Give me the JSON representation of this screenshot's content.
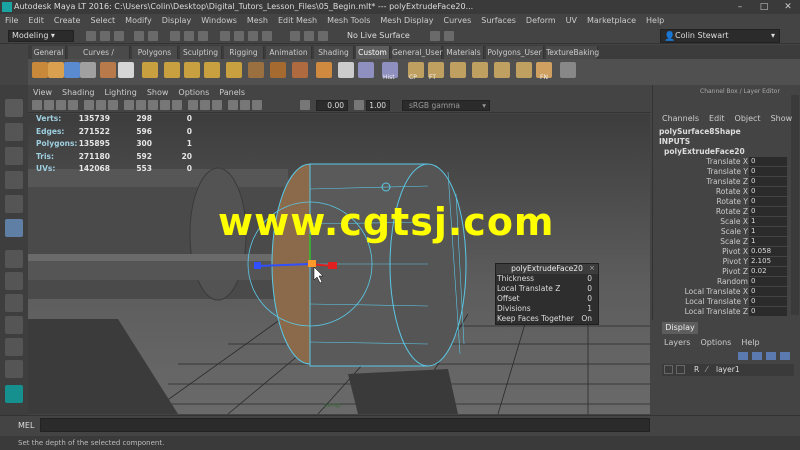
{
  "window": {
    "title": "Autodesk Maya LT 2016: C:\\Users\\Colin\\Desktop\\Digital_Tutors_Lesson_Files\\05_Begin.mlt*  ---  polyExtrudeFace20..."
  },
  "menubar": [
    "File",
    "Edit",
    "Create",
    "Select",
    "Modify",
    "Display",
    "Windows",
    "Mesh",
    "Edit Mesh",
    "Mesh Tools",
    "Mesh Display",
    "Curves",
    "Surfaces",
    "Deform",
    "UV",
    "Marketplace",
    "Help"
  ],
  "status_line": {
    "mode": "Modeling",
    "live_surface": "No Live Surface",
    "user": "Colin Stewart"
  },
  "shelf_tabs": [
    {
      "label": "General",
      "active": false
    },
    {
      "label": "Curves / Surfaces",
      "active": false
    },
    {
      "label": "Polygons",
      "active": false
    },
    {
      "label": "Sculpting",
      "active": false
    },
    {
      "label": "Rigging",
      "active": false
    },
    {
      "label": "Animation",
      "active": false
    },
    {
      "label": "Shading",
      "active": false
    },
    {
      "label": "Custom",
      "active": true
    },
    {
      "label": "General_User",
      "active": false
    },
    {
      "label": "Materials",
      "active": false
    },
    {
      "label": "Polygons_User",
      "active": false
    },
    {
      "label": "TextureBaking",
      "active": false
    }
  ],
  "shelf_labels": {
    "hist": "Hist",
    "cp": "CP",
    "ft": "FT",
    "fn": "FN"
  },
  "viewport": {
    "menu": [
      "View",
      "Shading",
      "Lighting",
      "Show",
      "Options",
      "Panels"
    ],
    "field1": "0.00",
    "field2": "1.00",
    "color_space": "sRGB gamma",
    "hud": [
      {
        "label": "Verts:",
        "a": "135739",
        "b": "298",
        "c": "0"
      },
      {
        "label": "Edges:",
        "a": "271522",
        "b": "596",
        "c": "0"
      },
      {
        "label": "Polygons:",
        "a": "135895",
        "b": "300",
        "c": "1"
      },
      {
        "label": "Tris:",
        "a": "271180",
        "b": "592",
        "c": "20"
      },
      {
        "label": "UVs:",
        "a": "142068",
        "b": "553",
        "c": "0"
      }
    ],
    "camera_label": "persp",
    "watermark": "www.cgtsj.com"
  },
  "popup": {
    "title": "polyExtrudeFace20",
    "rows": [
      {
        "label": "Thickness",
        "value": "0"
      },
      {
        "label": "Local Translate Z",
        "value": "0"
      },
      {
        "label": "Offset",
        "value": "0"
      },
      {
        "label": "Divisions",
        "value": "1"
      },
      {
        "label": "Keep Faces Together",
        "value": "On"
      }
    ]
  },
  "channel_box": {
    "title": "Channel Box / Layer Editor",
    "menu": [
      "Channels",
      "Edit",
      "Object",
      "Show"
    ],
    "object": "polySurface8Shape",
    "inputs": "INPUTS",
    "node": "polyExtrudeFace20",
    "attrs": [
      {
        "label": "Translate X",
        "value": "0"
      },
      {
        "label": "Translate Y",
        "value": "0"
      },
      {
        "label": "Translate Z",
        "value": "0"
      },
      {
        "label": "Rotate X",
        "value": "0"
      },
      {
        "label": "Rotate Y",
        "value": "0"
      },
      {
        "label": "Rotate Z",
        "value": "0"
      },
      {
        "label": "Scale X",
        "value": "1"
      },
      {
        "label": "Scale Y",
        "value": "1"
      },
      {
        "label": "Scale Z",
        "value": "1"
      },
      {
        "label": "Pivot X",
        "value": "0.058"
      },
      {
        "label": "Pivot Y",
        "value": "2.105"
      },
      {
        "label": "Pivot Z",
        "value": "0.02"
      },
      {
        "label": "Random",
        "value": "0"
      },
      {
        "label": "Local Translate X",
        "value": "0"
      },
      {
        "label": "Local Translate Y",
        "value": "0"
      },
      {
        "label": "Local Translate Z",
        "value": "0"
      }
    ]
  },
  "layer_panel": {
    "tab": "Display",
    "menu": [
      "Layers",
      "Options",
      "Help"
    ],
    "layer_flag": "R",
    "layer_name": "layer1"
  },
  "command_line": {
    "label": "MEL"
  },
  "help_line": "Set the depth of the selected component.",
  "colors": {
    "accent": "#5bc8e6",
    "watermark": "#ffff00",
    "active_tab": "#5d5d5d"
  }
}
